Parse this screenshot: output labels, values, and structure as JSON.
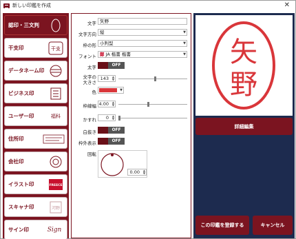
{
  "window": {
    "title": "新しい印鑑を作成",
    "close_glyph": "✕"
  },
  "sidebar": {
    "items": [
      {
        "label": "認印・三文判",
        "thumb": "",
        "active": true
      },
      {
        "label": "干支印",
        "thumb": "干支"
      },
      {
        "label": "データネーム印",
        "thumb": ""
      },
      {
        "label": "ビジネス印",
        "thumb": ""
      },
      {
        "label": "ユーザー印",
        "thumb": "福科"
      },
      {
        "label": "住所印",
        "thumb": ""
      },
      {
        "label": "会社印",
        "thumb": ""
      },
      {
        "label": "イラスト印",
        "thumb": "FREECE"
      },
      {
        "label": "スキャナ印",
        "thumb": "河野"
      },
      {
        "label": "サイン印",
        "thumb": "Sign"
      }
    ]
  },
  "form": {
    "text_label": "文字",
    "text_value": "矢野",
    "direction_label": "文字方向",
    "direction_value": "縦",
    "frame_label": "枠の形",
    "frame_value": "小判型",
    "font_label": "フォント",
    "font_glyph": "鄭",
    "font_value": "JA 楷書 楷書",
    "bold_label": "太字",
    "bold_state": "OFF",
    "size_label_1": "文字の",
    "size_label_2": "大きさ",
    "size_value": "143",
    "color_label": "色",
    "color_hex": "#d9363a",
    "border_label": "枠線幅",
    "border_value": "4.00",
    "blur_label": "かすれ",
    "blur_value": "0",
    "outline_label": "白抜き",
    "outline_state": "OFF",
    "outer_label": "枠外表示",
    "outer_state": "OFF",
    "rotate_label": "回転",
    "rotate_value": "0.00"
  },
  "preview": {
    "stamp_text_top": "矢",
    "stamp_text_bottom": "野",
    "stamp_color": "#d9363a"
  },
  "buttons": {
    "detail": "詳細編集",
    "register": "この印鑑を登録する",
    "cancel": "キャンセル"
  }
}
